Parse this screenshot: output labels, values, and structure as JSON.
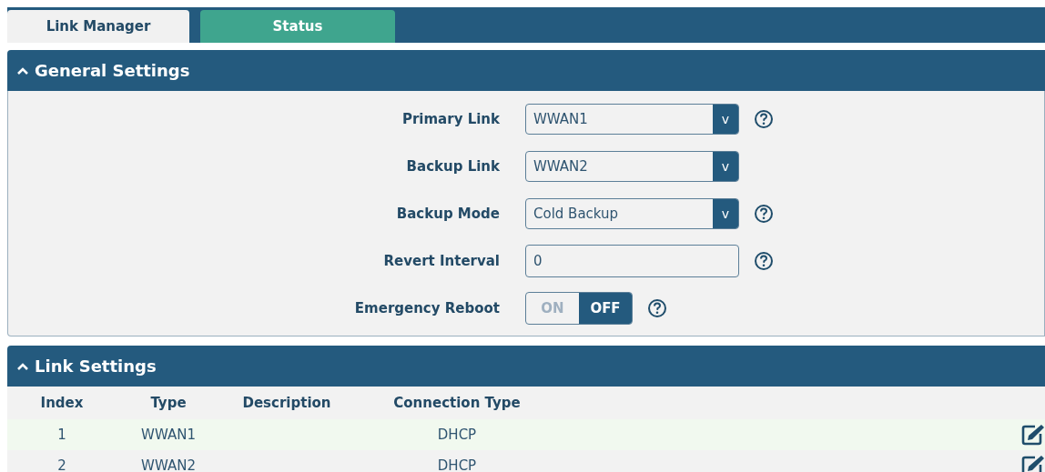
{
  "tabs": [
    {
      "label": "Link Manager",
      "selected": true
    },
    {
      "label": "Status",
      "selected": false
    }
  ],
  "general_settings": {
    "title": "General Settings",
    "expanded": true,
    "fields": [
      {
        "kind": "select",
        "label": "Primary Link",
        "value": "WWAN1",
        "arrow": "v",
        "help": true
      },
      {
        "kind": "select",
        "label": "Backup Link",
        "value": "WWAN2",
        "arrow": "v",
        "help": false
      },
      {
        "kind": "select",
        "label": "Backup Mode",
        "value": "Cold Backup",
        "arrow": "v",
        "help": true
      },
      {
        "kind": "text",
        "label": "Revert Interval",
        "value": "0",
        "help": true
      },
      {
        "kind": "toggle",
        "label": "Emergency Reboot",
        "on_label": "ON",
        "off_label": "OFF",
        "on": false,
        "help": true
      }
    ]
  },
  "link_settings": {
    "title": "Link Settings",
    "expanded": true,
    "columns": [
      "Index",
      "Type",
      "Description",
      "Connection Type"
    ],
    "rows": [
      {
        "cells": [
          "1",
          "WWAN1",
          "",
          "DHCP"
        ]
      },
      {
        "cells": [
          "2",
          "WWAN2",
          "",
          "DHCP"
        ]
      }
    ]
  }
}
